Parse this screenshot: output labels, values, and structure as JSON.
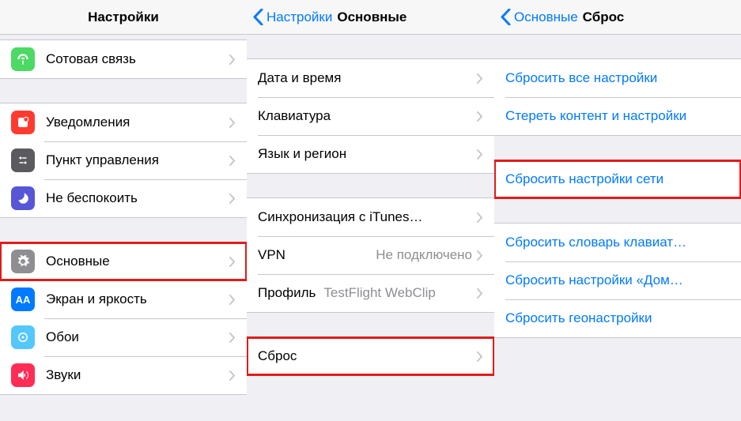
{
  "screen1": {
    "title": "Настройки",
    "items": {
      "cellular": "Сотовая связь",
      "notifications": "Уведомления",
      "controlcenter": "Пункт управления",
      "dnd": "Не беспокоить",
      "general": "Основные",
      "display": "Экран и яркость",
      "wallpaper": "Обои",
      "sounds": "Звуки"
    }
  },
  "screen2": {
    "back": "Настройки",
    "title": "Основные",
    "items": {
      "datetime": "Дата и время",
      "keyboard": "Клавиатура",
      "language": "Язык и регион",
      "itunes": "Синхронизация с iTunes…",
      "vpn_label": "VPN",
      "vpn_value": "Не подключено",
      "profile_label": "Профиль",
      "profile_value": "TestFlight WebClip",
      "reset": "Сброс"
    }
  },
  "screen3": {
    "back": "Основные",
    "title": "Сброс",
    "items": {
      "reset_all": "Сбросить все настройки",
      "erase_all": "Стереть контент и настройки",
      "reset_network": "Сбросить настройки сети",
      "reset_keyboard": "Сбросить словарь клавиат…",
      "reset_home": "Сбросить настройки «Дом…",
      "reset_location": "Сбросить геонастройки"
    }
  }
}
